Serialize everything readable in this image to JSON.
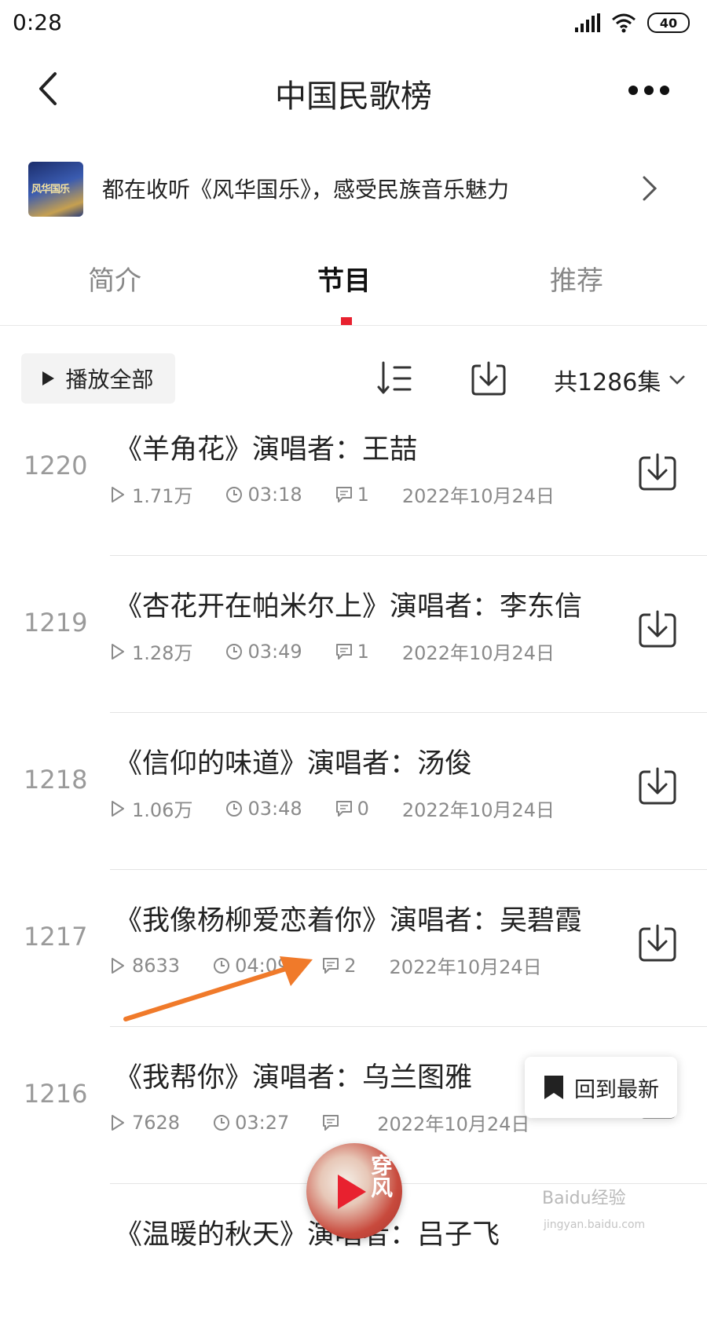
{
  "status_bar": {
    "time": "0:28",
    "battery": "40"
  },
  "header": {
    "title": "中国民歌榜"
  },
  "promo": {
    "text": "都在收听《风华国乐》，感受民族音乐魅力",
    "thumb_label": "风华国乐"
  },
  "tabs": [
    {
      "label": "简介",
      "active": false
    },
    {
      "label": "节目",
      "active": true
    },
    {
      "label": "推荐",
      "active": false
    }
  ],
  "toolbar": {
    "play_all": "播放全部",
    "count": "共1286集"
  },
  "episodes": [
    {
      "num": "1220",
      "title": "《羊角花》演唱者：王喆",
      "plays": "1.71万",
      "duration": "03:18",
      "comments": "1",
      "date": "2022年10月24日"
    },
    {
      "num": "1219",
      "title": "《杏花开在帕米尔上》演唱者：李东信",
      "plays": "1.28万",
      "duration": "03:49",
      "comments": "1",
      "date": "2022年10月24日"
    },
    {
      "num": "1218",
      "title": "《信仰的味道》演唱者：汤俊",
      "plays": "1.06万",
      "duration": "03:48",
      "comments": "0",
      "date": "2022年10月24日"
    },
    {
      "num": "1217",
      "title": "《我像杨柳爱恋着你》演唱者：吴碧霞",
      "plays": "8633",
      "duration": "04:09",
      "comments": "2",
      "date": "2022年10月24日"
    },
    {
      "num": "1216",
      "title": "《我帮你》演唱者：乌兰图雅",
      "plays": "7628",
      "duration": "03:27",
      "comments": "",
      "date": "2022年10月24日"
    },
    {
      "num": "",
      "title": "《温暖的秋天》演唱者：吕子飞",
      "plays": "",
      "duration": "",
      "comments": "",
      "date": ""
    }
  ],
  "floating": {
    "back_to_latest": "回到最新",
    "player_cover": "穿风"
  },
  "watermark": {
    "text": "Baidu经验",
    "sub": "jingyan.baidu.com"
  },
  "colors": {
    "accent": "#e8212f",
    "annotation_arrow": "#f07a2a"
  }
}
